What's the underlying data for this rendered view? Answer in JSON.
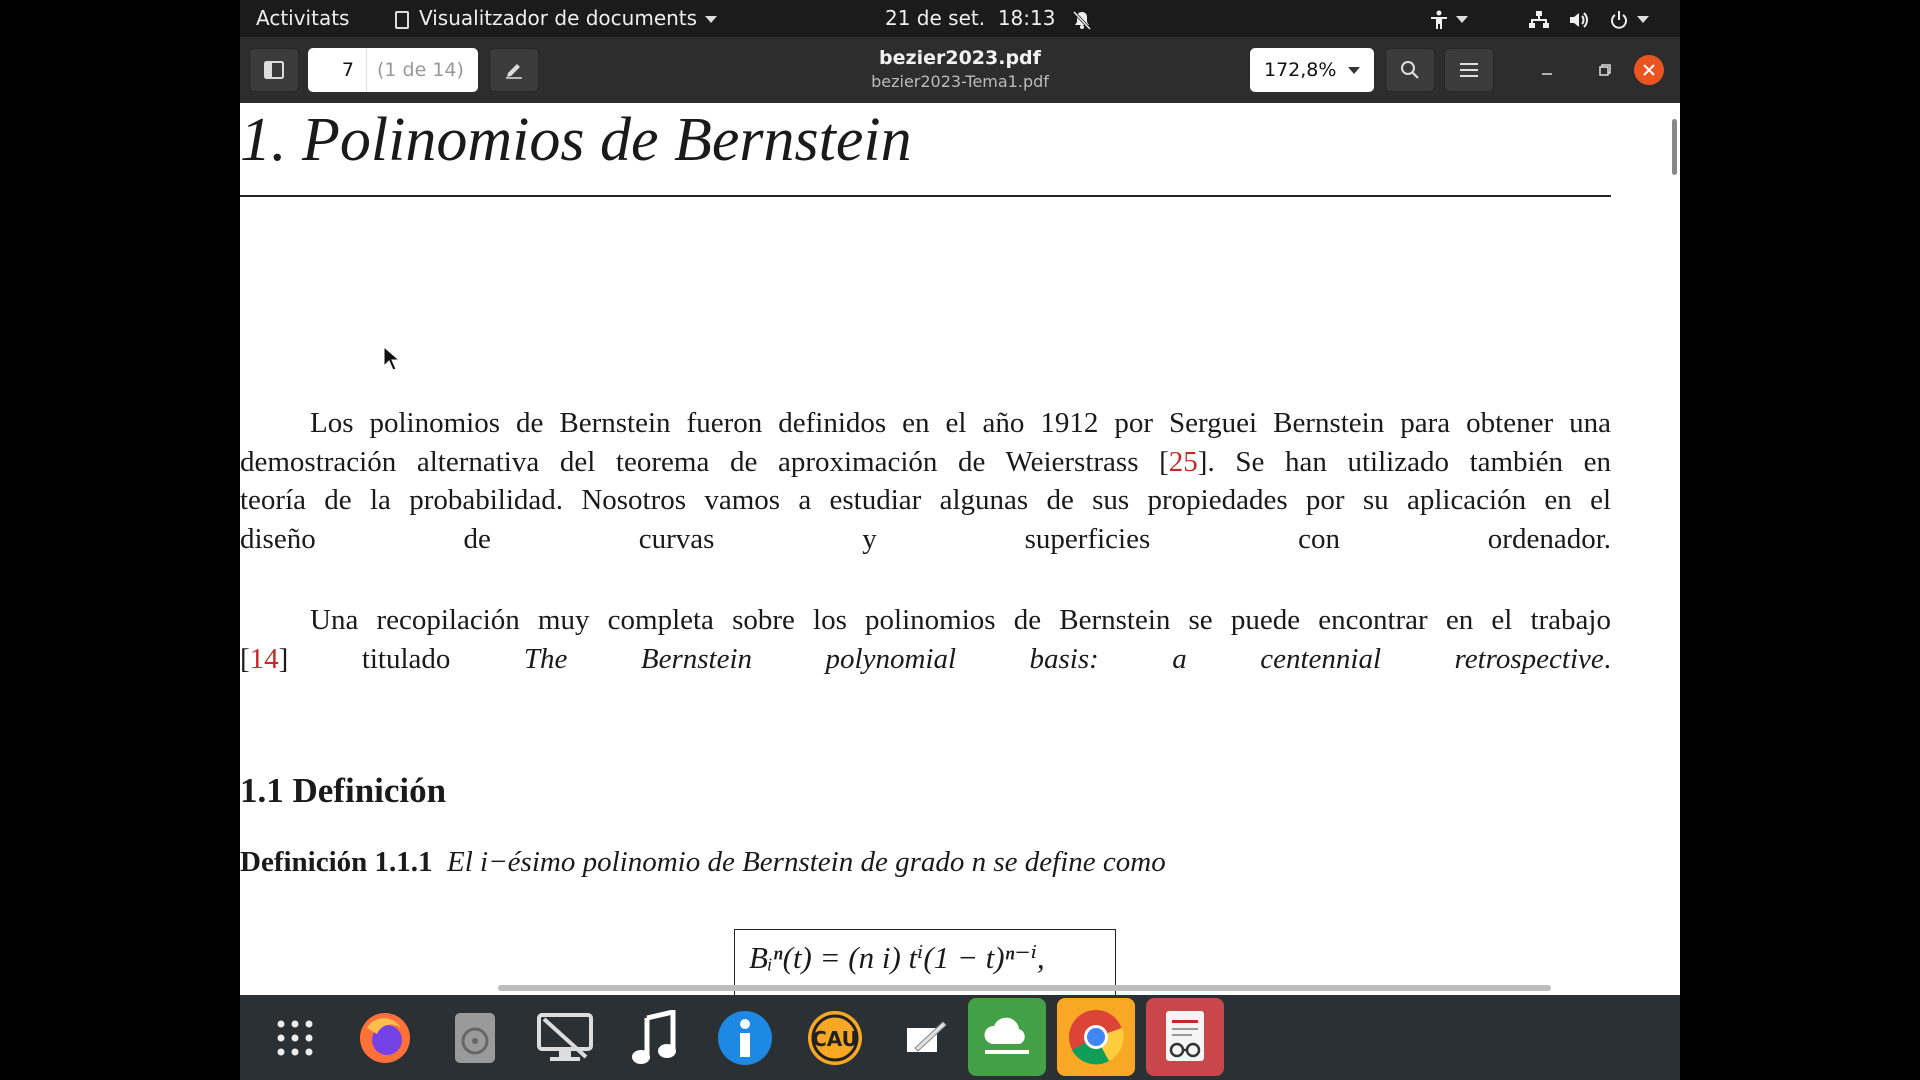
{
  "topbar": {
    "activities": "Activitats",
    "app_name": "Visualitzador de documents",
    "date": "21 de set.",
    "time": "18:13"
  },
  "headerbar": {
    "page_current": "7",
    "page_count": "(1 de 14)",
    "title": "bezier2023.pdf",
    "subtitle": "bezier2023-Tema1.pdf",
    "zoom": "172,8%"
  },
  "document": {
    "chapter_title": "1. Polinomios de Bernstein",
    "para1": {
      "line1": "Los polinomios de Bernstein fueron definidos en el año 1912 por Serguei Bernstein para obtener una",
      "line2_pre": "demostración alternativa del teorema de aproximación de Weierstrass [",
      "cite1": "25",
      "line2_post": "]. Se han utilizado también en",
      "line3": "teoría de la probabilidad. Nosotros vamos a estudiar algunas de sus propiedades por su aplicación en el",
      "line4": "diseño de curvas y superficies con ordenador."
    },
    "para2": {
      "line1": "Una recopilación muy completa sobre los polinomios de Bernstein se puede encontrar en el trabajo",
      "open_bracket": "[",
      "cite2": "14",
      "line2_mid": "] titulado ",
      "line2_italic": "The Bernstein polynomial basis: a centennial retrospective",
      "line2_end": "."
    },
    "section_title": "1.1 Definición",
    "definition_label": "Definición 1.1.1",
    "definition_text": "El i−ésimo polinomio de Bernstein de grado n se define como",
    "formula": "Bᵢⁿ(t) = (n i) tⁱ(1 − t)ⁿ⁻ⁱ,"
  },
  "dock": {
    "icons": [
      "app-grid-icon",
      "firefox-icon",
      "disk-icon",
      "remote-desktop-icon",
      "music-icon",
      "info-icon",
      "cau-icon",
      "notes-icon",
      "cloud-icon",
      "chrome-icon",
      "document-viewer-icon"
    ]
  },
  "colors": {
    "topbar": "#1b1b1b",
    "headerbar": "#2d2d2d",
    "close_button": "#e95420",
    "citation": "#c62828",
    "dock": "#2b3035"
  }
}
